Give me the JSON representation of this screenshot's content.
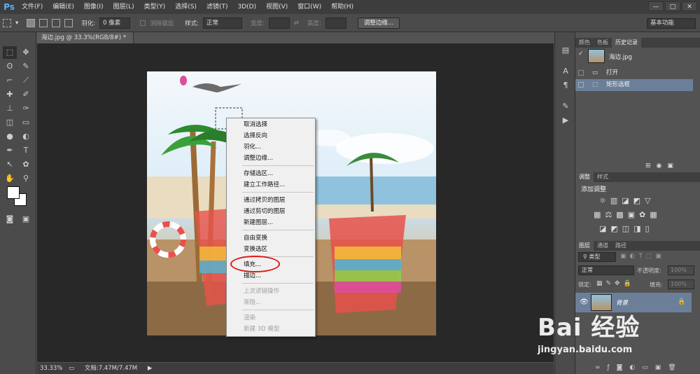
{
  "app": {
    "logo": "Ps"
  },
  "menu": [
    "文件(F)",
    "编辑(E)",
    "图像(I)",
    "图层(L)",
    "类型(Y)",
    "选择(S)",
    "滤镜(T)",
    "3D(D)",
    "视图(V)",
    "窗口(W)",
    "帮助(H)"
  ],
  "window_controls": {
    "min": "—",
    "restore": "□",
    "close": "✕"
  },
  "options": {
    "feather_label": "羽化:",
    "feather_value": "0 像素",
    "antialias_label": "消除锯齿",
    "style_label": "样式:",
    "style_value": "正常",
    "width_label": "宽度:",
    "height_label": "高度:",
    "refine_button": "调整边缘...",
    "workspace": "基本功能"
  },
  "document": {
    "tab_title": "海边.jpg @ 33.3%(RGB/8#) *",
    "close": "×"
  },
  "status": {
    "zoom": "33.33%",
    "doc_info": "文档:7.47M/7.47M"
  },
  "history_panel": {
    "tabs": [
      "颜色",
      "色板",
      "历史记录"
    ],
    "snapshot": "海边.jpg",
    "items": [
      "打开",
      "矩形选框"
    ]
  },
  "adjust_panel": {
    "tabs": [
      "调整",
      "样式"
    ],
    "title": "添加调整"
  },
  "layers_panel": {
    "tabs": [
      "图层",
      "通道",
      "路径"
    ],
    "filter": "类型",
    "blend": "正常",
    "opacity_label": "不透明度:",
    "opacity_value": "100%",
    "lock_label": "锁定:",
    "fill_label": "填充:",
    "fill_value": "100%",
    "layer_name": "背景"
  },
  "context_menu": {
    "groups": [
      [
        "取消选择",
        "选择反向",
        "羽化...",
        "调整边缘..."
      ],
      [
        "存储选区...",
        "建立工作路径..."
      ],
      [
        "通过拷贝的图层",
        "通过剪切的图层",
        "新建图层..."
      ],
      [
        "自由变换",
        "变换选区"
      ],
      [
        "填充...",
        "描边..."
      ],
      [
        "上次滤镜操作",
        "渐隐..."
      ],
      [
        "渲染",
        "新建 3D 模型"
      ]
    ],
    "disabled": [
      "上次滤镜操作",
      "渐隐...",
      "渲染",
      "新建 3D 模型"
    ]
  },
  "watermark": {
    "brand": "Bai 经验",
    "url": "jingyan.baidu.com"
  },
  "colors": {
    "accent_highlight": "#e01818",
    "selection": "#6b7f99"
  }
}
